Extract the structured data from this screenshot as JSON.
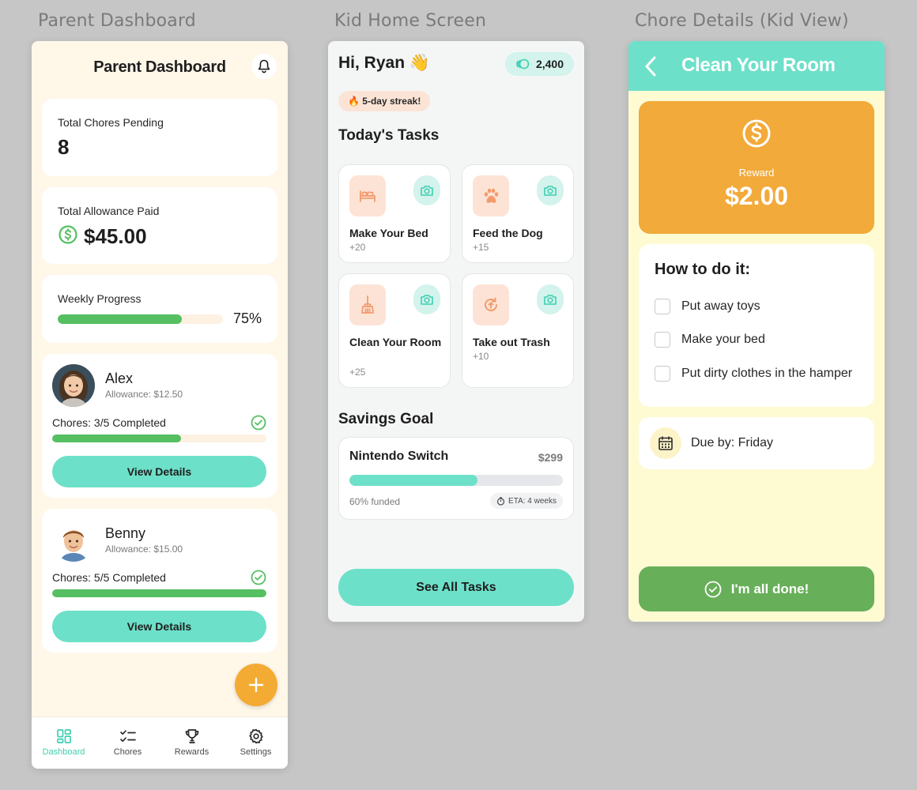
{
  "screen_labels": {
    "parent": "Parent Dashboard",
    "kid": "Kid Home Screen",
    "chore": "Chore Details (Kid View)"
  },
  "parent": {
    "title": "Parent Dashboard",
    "pending": {
      "label": "Total Chores Pending",
      "value": "8"
    },
    "allowance": {
      "label": "Total Allowance Paid",
      "value": "$45.00"
    },
    "weekly": {
      "label": "Weekly Progress",
      "percent_text": "75%",
      "fraction": 0.75
    },
    "kids": [
      {
        "name": "Alex",
        "allowance": "Allowance: $12.50",
        "chores": "Chores: 3/5 Completed",
        "fraction": 0.6,
        "button": "View Details"
      },
      {
        "name": "Benny",
        "allowance": "Allowance: $15.00",
        "chores": "Chores: 5/5 Completed",
        "fraction": 1.0,
        "button": "View Details"
      }
    ],
    "tabs": [
      {
        "label": "Dashboard",
        "icon": "dashboard-icon",
        "active": true
      },
      {
        "label": "Chores",
        "icon": "checklist-icon",
        "active": false
      },
      {
        "label": "Rewards",
        "icon": "trophy-icon",
        "active": false
      },
      {
        "label": "Settings",
        "icon": "gear-icon",
        "active": false
      }
    ],
    "colors": {
      "accent": "#6de0c9",
      "progress": "#55bf62",
      "fab": "#f4ab33",
      "background": "#fff7e8"
    }
  },
  "kid": {
    "greeting": "Hi, Ryan 👋",
    "coins": "2,400",
    "streak": "🔥 5-day streak!",
    "tasks_title": "Today's Tasks",
    "tasks": [
      {
        "name": "Make Your Bed",
        "points": "+20",
        "icon": "bed-icon"
      },
      {
        "name": "Feed the Dog",
        "points": "+15",
        "icon": "paw-icon"
      },
      {
        "name": "Clean Your Room",
        "points": "+25",
        "icon": "broom-icon"
      },
      {
        "name": "Take out Trash",
        "points": "+10",
        "icon": "recycle-icon"
      }
    ],
    "savings_title": "Savings Goal",
    "savings": {
      "name": "Nintendo Switch",
      "price": "$299",
      "funded_text": "60% funded",
      "fraction": 0.6,
      "eta": "ETA: 4 weeks"
    },
    "see_all": "See All Tasks",
    "colors": {
      "accent": "#6de0c9",
      "task_icon_bg": "#fde3d6"
    }
  },
  "chore": {
    "title": "Clean Your Room",
    "reward_label": "Reward",
    "reward_amount": "$2.00",
    "howto_title": "How to do it:",
    "steps": [
      "Put away toys",
      "Make your bed",
      "Put dirty clothes in the hamper"
    ],
    "due": "Due by: Friday",
    "done_button": "I'm all done!",
    "colors": {
      "header": "#6de0c9",
      "reward_card": "#f2aa3a",
      "done_button": "#68af5a",
      "background": "#fefbd3"
    }
  }
}
